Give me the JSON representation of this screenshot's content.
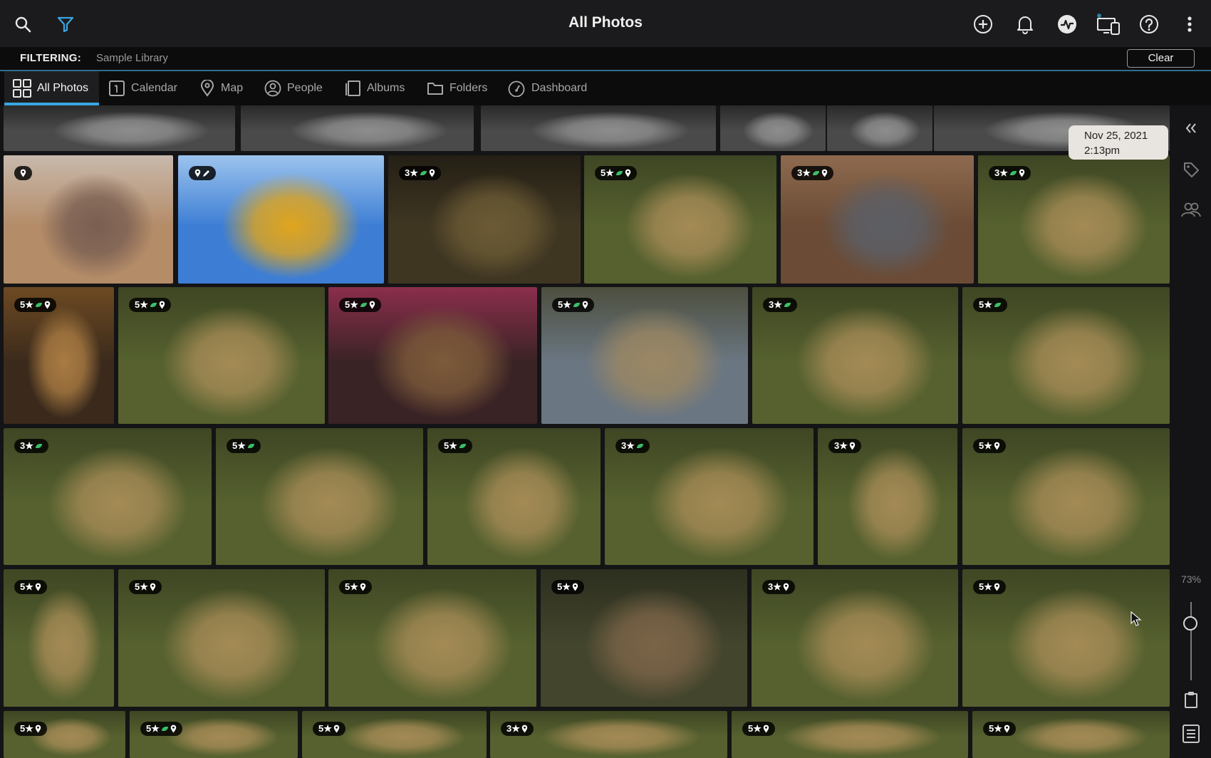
{
  "header": {
    "title": "All Photos",
    "icons": [
      "search-icon",
      "filter-icon",
      "add-circle-icon",
      "bell-icon",
      "activity-icon",
      "devices-icon",
      "help-icon",
      "more-vertical-icon"
    ]
  },
  "filter": {
    "label": "FILTERING:",
    "value": "Sample Library",
    "clear_label": "Clear"
  },
  "tabs": [
    {
      "label": "All Photos",
      "icon": "grid-icon",
      "active": true
    },
    {
      "label": "Calendar",
      "icon": "calendar-icon",
      "active": false
    },
    {
      "label": "Map",
      "icon": "map-pin-icon",
      "active": false
    },
    {
      "label": "People",
      "icon": "person-icon",
      "active": false
    },
    {
      "label": "Albums",
      "icon": "album-icon",
      "active": false
    },
    {
      "label": "Folders",
      "icon": "folder-icon",
      "active": false
    },
    {
      "label": "Dashboard",
      "icon": "dashboard-icon",
      "active": false
    }
  ],
  "date_tooltip": {
    "date": "Nov 25, 2021",
    "time": "2:13pm"
  },
  "zoom": {
    "label": "73%",
    "level": 0.73
  },
  "sidebar_icons": [
    "collapse-icon",
    "tag-icon",
    "people-group-icon",
    "clipboard-icon",
    "list-icon"
  ],
  "photos": [
    {
      "badge": "",
      "subject": "bw-street"
    },
    {
      "badge": "",
      "subject": "bw-rocks"
    },
    {
      "badge": "",
      "subject": "bw-road"
    },
    {
      "badge": "",
      "subject": "bw-tree"
    },
    {
      "badge": "",
      "subject": "bw-bark"
    },
    {
      "badge": "",
      "subject": "bw-building"
    },
    {
      "badge": "",
      "icons": [
        "pin"
      ],
      "subject": "family-selfie"
    },
    {
      "badge": "",
      "icons": [
        "pin",
        "edit"
      ],
      "subject": "autumn-lake"
    },
    {
      "badge": "3★",
      "icons": [
        "leaf",
        "pin"
      ],
      "subject": "jackals-road"
    },
    {
      "badge": "5★",
      "icons": [
        "leaf",
        "pin"
      ],
      "subject": "lion-cubs"
    },
    {
      "badge": "3★",
      "icons": [
        "leaf",
        "pin"
      ],
      "subject": "elephant-water"
    },
    {
      "badge": "3★",
      "icons": [
        "leaf",
        "pin"
      ],
      "subject": "cubs-grass"
    },
    {
      "badge": "5★",
      "icons": [
        "leaf",
        "pin"
      ],
      "subject": "lion-face"
    },
    {
      "badge": "5★",
      "icons": [
        "leaf",
        "pin"
      ],
      "subject": "lion-cub"
    },
    {
      "badge": "5★",
      "icons": [
        "leaf",
        "pin"
      ],
      "subject": "lion-eating"
    },
    {
      "badge": "5★",
      "icons": [
        "leaf",
        "pin"
      ],
      "subject": "lionesses"
    },
    {
      "badge": "3★",
      "icons": [
        "leaf"
      ],
      "subject": "cheetahs"
    },
    {
      "badge": "5★",
      "icons": [
        "leaf"
      ],
      "subject": "cheetahs-two"
    },
    {
      "badge": "3★",
      "icons": [
        "leaf"
      ],
      "subject": "cheetah-run"
    },
    {
      "badge": "5★",
      "icons": [
        "leaf"
      ],
      "subject": "lioness-roar"
    },
    {
      "badge": "5★",
      "icons": [
        "leaf"
      ],
      "subject": "leopard-walk"
    },
    {
      "badge": "3★",
      "icons": [
        "leaf"
      ],
      "subject": "leopard-rock"
    },
    {
      "badge": "3★",
      "icons": [
        "pin"
      ],
      "subject": "serval-sit"
    },
    {
      "badge": "5★",
      "icons": [
        "pin"
      ],
      "subject": "serval-leap"
    },
    {
      "badge": "5★",
      "icons": [
        "pin"
      ],
      "subject": "lioness-cub"
    },
    {
      "badge": "5★",
      "icons": [
        "pin"
      ],
      "subject": "cub-walk"
    },
    {
      "badge": "5★",
      "icons": [
        "pin"
      ],
      "subject": "cubs-family"
    },
    {
      "badge": "5★",
      "icons": [
        "pin"
      ],
      "subject": "jackals"
    },
    {
      "badge": "3★",
      "icons": [
        "pin"
      ],
      "subject": "cub-grass"
    },
    {
      "badge": "5★",
      "icons": [
        "pin"
      ],
      "subject": "lioness-drink"
    },
    {
      "badge": "5★",
      "icons": [
        "pin"
      ],
      "subject": "baboons"
    },
    {
      "badge": "5★",
      "icons": [
        "leaf",
        "pin"
      ],
      "subject": "baboon"
    },
    {
      "badge": "5★",
      "icons": [
        "pin"
      ],
      "subject": "cubs"
    },
    {
      "badge": "3★",
      "icons": [
        "pin"
      ],
      "subject": "lion-mane"
    },
    {
      "badge": "5★",
      "icons": [
        "pin"
      ],
      "subject": "savanna"
    },
    {
      "badge": "5★",
      "icons": [
        "pin"
      ],
      "subject": "grass"
    }
  ],
  "colors": {
    "accent": "#39a6e0",
    "leaf": "#3bbf6a"
  }
}
